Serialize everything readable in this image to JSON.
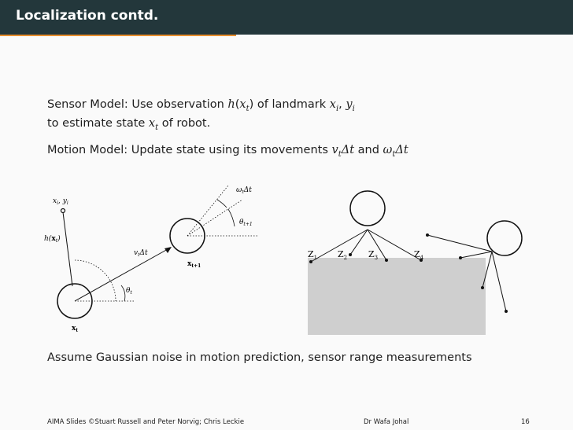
{
  "header": {
    "title": "Localization contd."
  },
  "body": {
    "sensor_line1_a": "Sensor Model: Use observation ",
    "sensor_h": "h",
    "sensor_paren_open": "(",
    "sensor_x": "x",
    "sensor_t": "t",
    "sensor_line1_b": ") of landmark ",
    "sensor_xi": "x",
    "sensor_i1": "i",
    "sensor_comma": ", ",
    "sensor_yi": "y",
    "sensor_i2": "i",
    "sensor_line2_a": "to estimate state ",
    "sensor_line2_x": "x",
    "sensor_line2_t": "t",
    "sensor_line2_b": " of robot.",
    "motion_a": "Motion Model: Update state using its movements ",
    "motion_v": "v",
    "motion_vt": "t",
    "motion_dt1": "Δt",
    "motion_and": " and ",
    "motion_w": "ω",
    "motion_wt": "t",
    "motion_dt2": "Δt",
    "assume": "Assume Gaussian noise in motion prediction, sensor range measurements"
  },
  "diagram_left": {
    "landmark_label": "x_i, y_i",
    "h_label": "h(x_t)",
    "v_label": "v_t Δt",
    "theta_t": "θ_t",
    "x_t": "x_t",
    "x_t1": "x_t+1",
    "omega_label": "ω_t Δt",
    "theta_t1": "θ_t+1"
  },
  "diagram_right": {
    "z_labels": [
      "Z1",
      "Z2",
      "Z3",
      "Z4"
    ],
    "block_color": "#cfcfcf"
  },
  "footer": {
    "left": "AIMA Slides ©Stuart Russell and Peter Norvig; Chris Leckie",
    "center": "Dr Wafa Johal",
    "page": "16"
  }
}
